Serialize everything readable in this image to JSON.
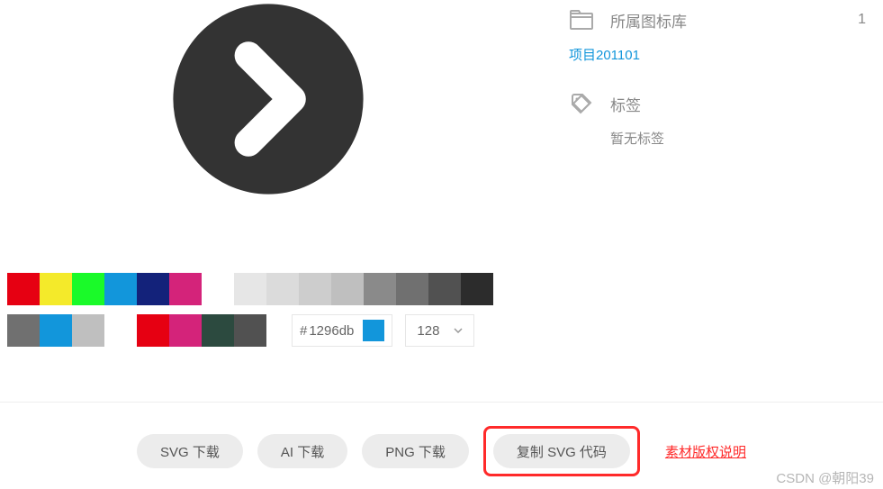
{
  "preview": {
    "icon_name": "chevron-right-circle-icon",
    "icon_fill": "#333333"
  },
  "palette": {
    "row1": [
      "#e60012",
      "#f4ea2a",
      "#1afa29",
      "#1296db",
      "#13227a",
      "#d4237a",
      "#ffffff",
      "#e6e6e6",
      "#dbdbdb",
      "#cdcdcd",
      "#bfbfbf",
      "#8a8a8a",
      "#707070",
      "#515151",
      "#2c2c2c"
    ],
    "row2": [
      "#707070",
      "#1296db",
      "#bfbfbf",
      "",
      "#e60012",
      "#d4237a",
      "#2c4a3f",
      "#515151"
    ]
  },
  "hex": {
    "prefix": "#",
    "value": "1296db",
    "preview_color": "#1296db"
  },
  "size_select": {
    "value": "128"
  },
  "meta": {
    "library_label": "所属图标库",
    "library_count": "1",
    "library_link": "项目201101",
    "tag_label": "标签",
    "tag_empty": "暂无标签"
  },
  "actions": {
    "svg_download": "SVG 下载",
    "ai_download": "AI 下载",
    "png_download": "PNG 下载",
    "copy_svg": "复制 SVG 代码",
    "copyright": "素材版权说明"
  },
  "watermark": "CSDN @朝阳39"
}
